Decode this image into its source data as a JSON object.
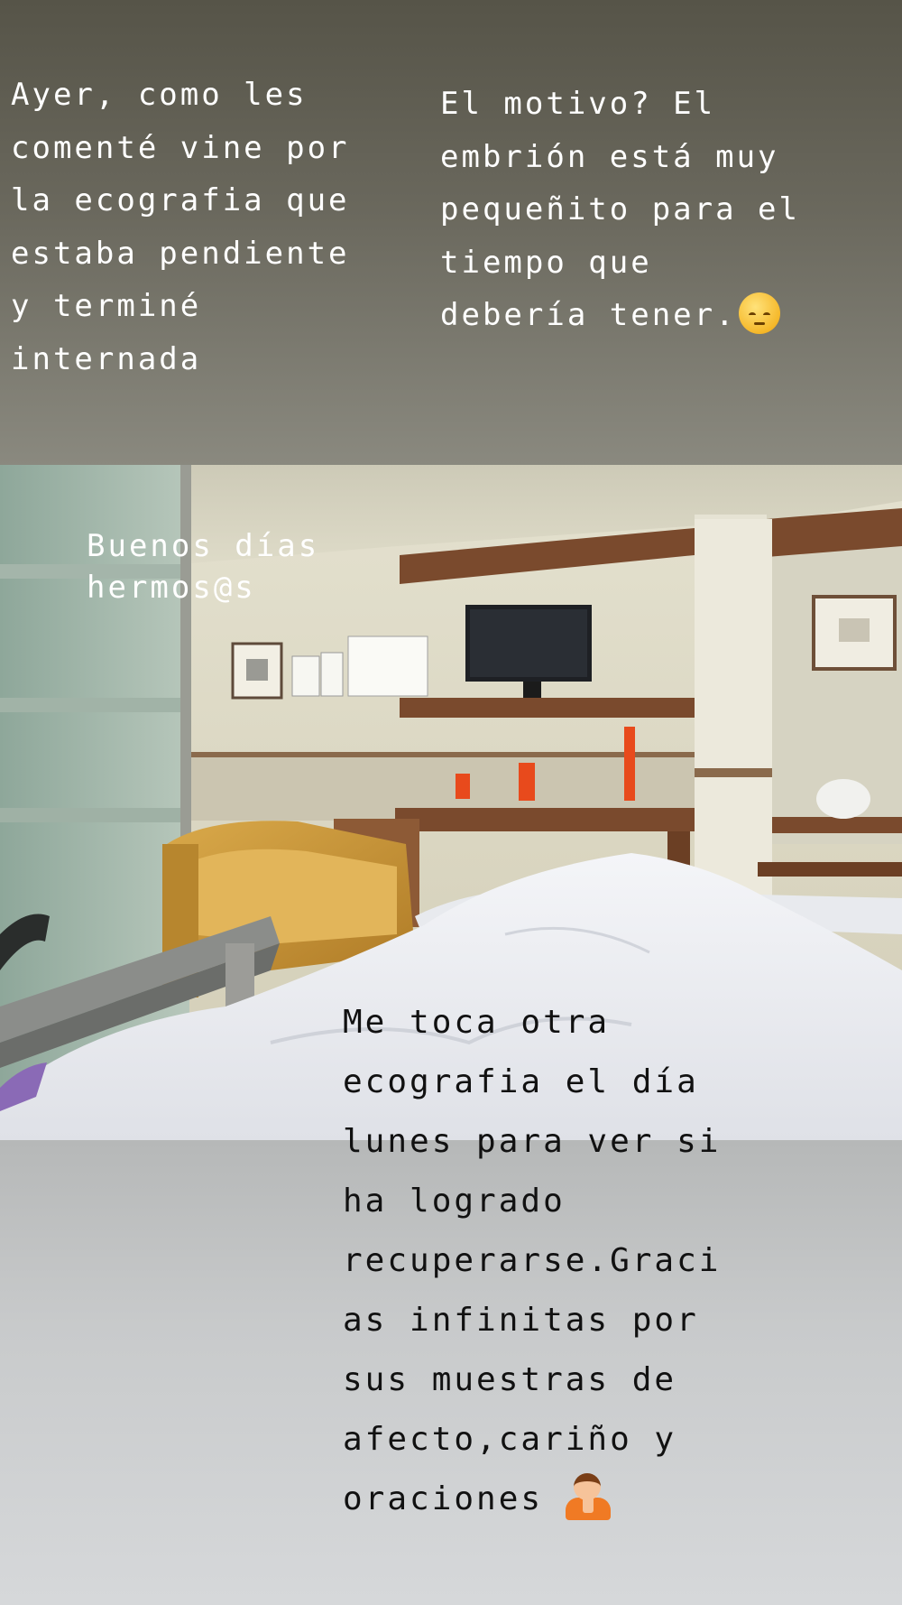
{
  "story": {
    "caption_intro": "Ayer, como les\ncomenté vine por\nla ecografia que\nestaba pendiente\ny terminé\ninternada",
    "caption_reason": "El motivo? El\nembrión está muy\npequeñito para el\ntiempo que\ndebería tener.",
    "caption_reason_emoji": "pensive-face-icon",
    "caption_greeting": "Buenos días\nhermos@s",
    "caption_update": "Me toca otra\necografia el día\nlunes para ver si\nha logrado\nrecuperarse.Graci\nas infinitas por\nsus muestras de\nafecto,cariño y\noraciones ",
    "caption_update_emoji": "praying-person-icon",
    "photo_subject": "hospital room from bed",
    "colors": {
      "top_background": "#5f5d52",
      "bottom_background": "#c9cbcc",
      "light_text": "#ffffff",
      "dark_text": "#111111"
    }
  }
}
